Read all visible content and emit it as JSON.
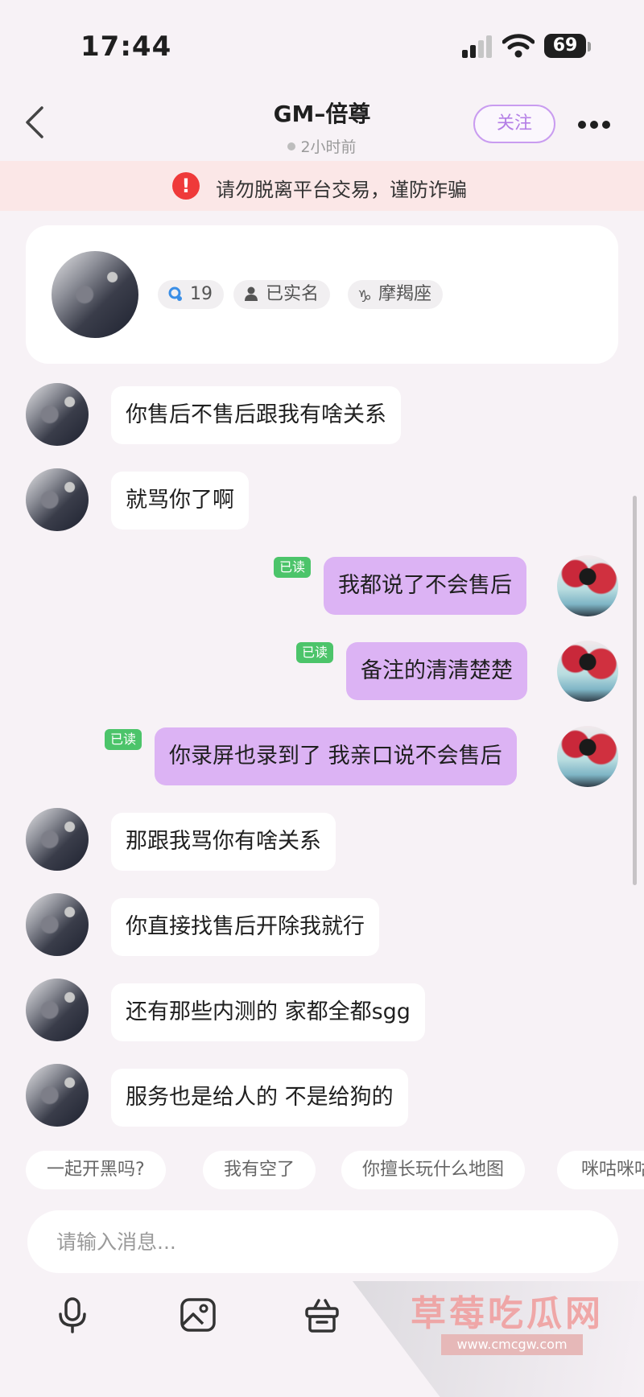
{
  "status_bar": {
    "time": "17:44",
    "battery": "69"
  },
  "header": {
    "title": "GM–倍尊",
    "presence": "2小时前",
    "follow_label": "关注"
  },
  "warning": {
    "text": "请勿脱离平台交易，谨防诈骗"
  },
  "profile": {
    "level": "19",
    "verified": "已实名",
    "zodiac": "摩羯座"
  },
  "messages": [
    {
      "side": "other",
      "text": "你售后不售后跟我有啥关系"
    },
    {
      "side": "other",
      "text": "就骂你了啊"
    },
    {
      "side": "me",
      "text": "我都说了不会售后",
      "read": "已读"
    },
    {
      "side": "me",
      "text": "备注的清清楚楚",
      "read": "已读"
    },
    {
      "side": "me",
      "text": "你录屏也录到了 我亲口说不会售后",
      "read": "已读"
    },
    {
      "side": "other",
      "text": "那跟我骂你有啥关系"
    },
    {
      "side": "other",
      "text": "你直接找售后开除我就行"
    },
    {
      "side": "other",
      "text": "还有那些内测的 家都全都sgg"
    },
    {
      "side": "other",
      "text": "服务也是给人的  不是给狗的"
    }
  ],
  "quick_replies": [
    "一起开黑吗?",
    "我有空了",
    "你擅长玩什么地图",
    "咪咕咪咕"
  ],
  "input": {
    "placeholder": "请输入消息..."
  },
  "watermark": {
    "title": "草莓吃瓜网",
    "url": "www.cmcgw.com"
  }
}
